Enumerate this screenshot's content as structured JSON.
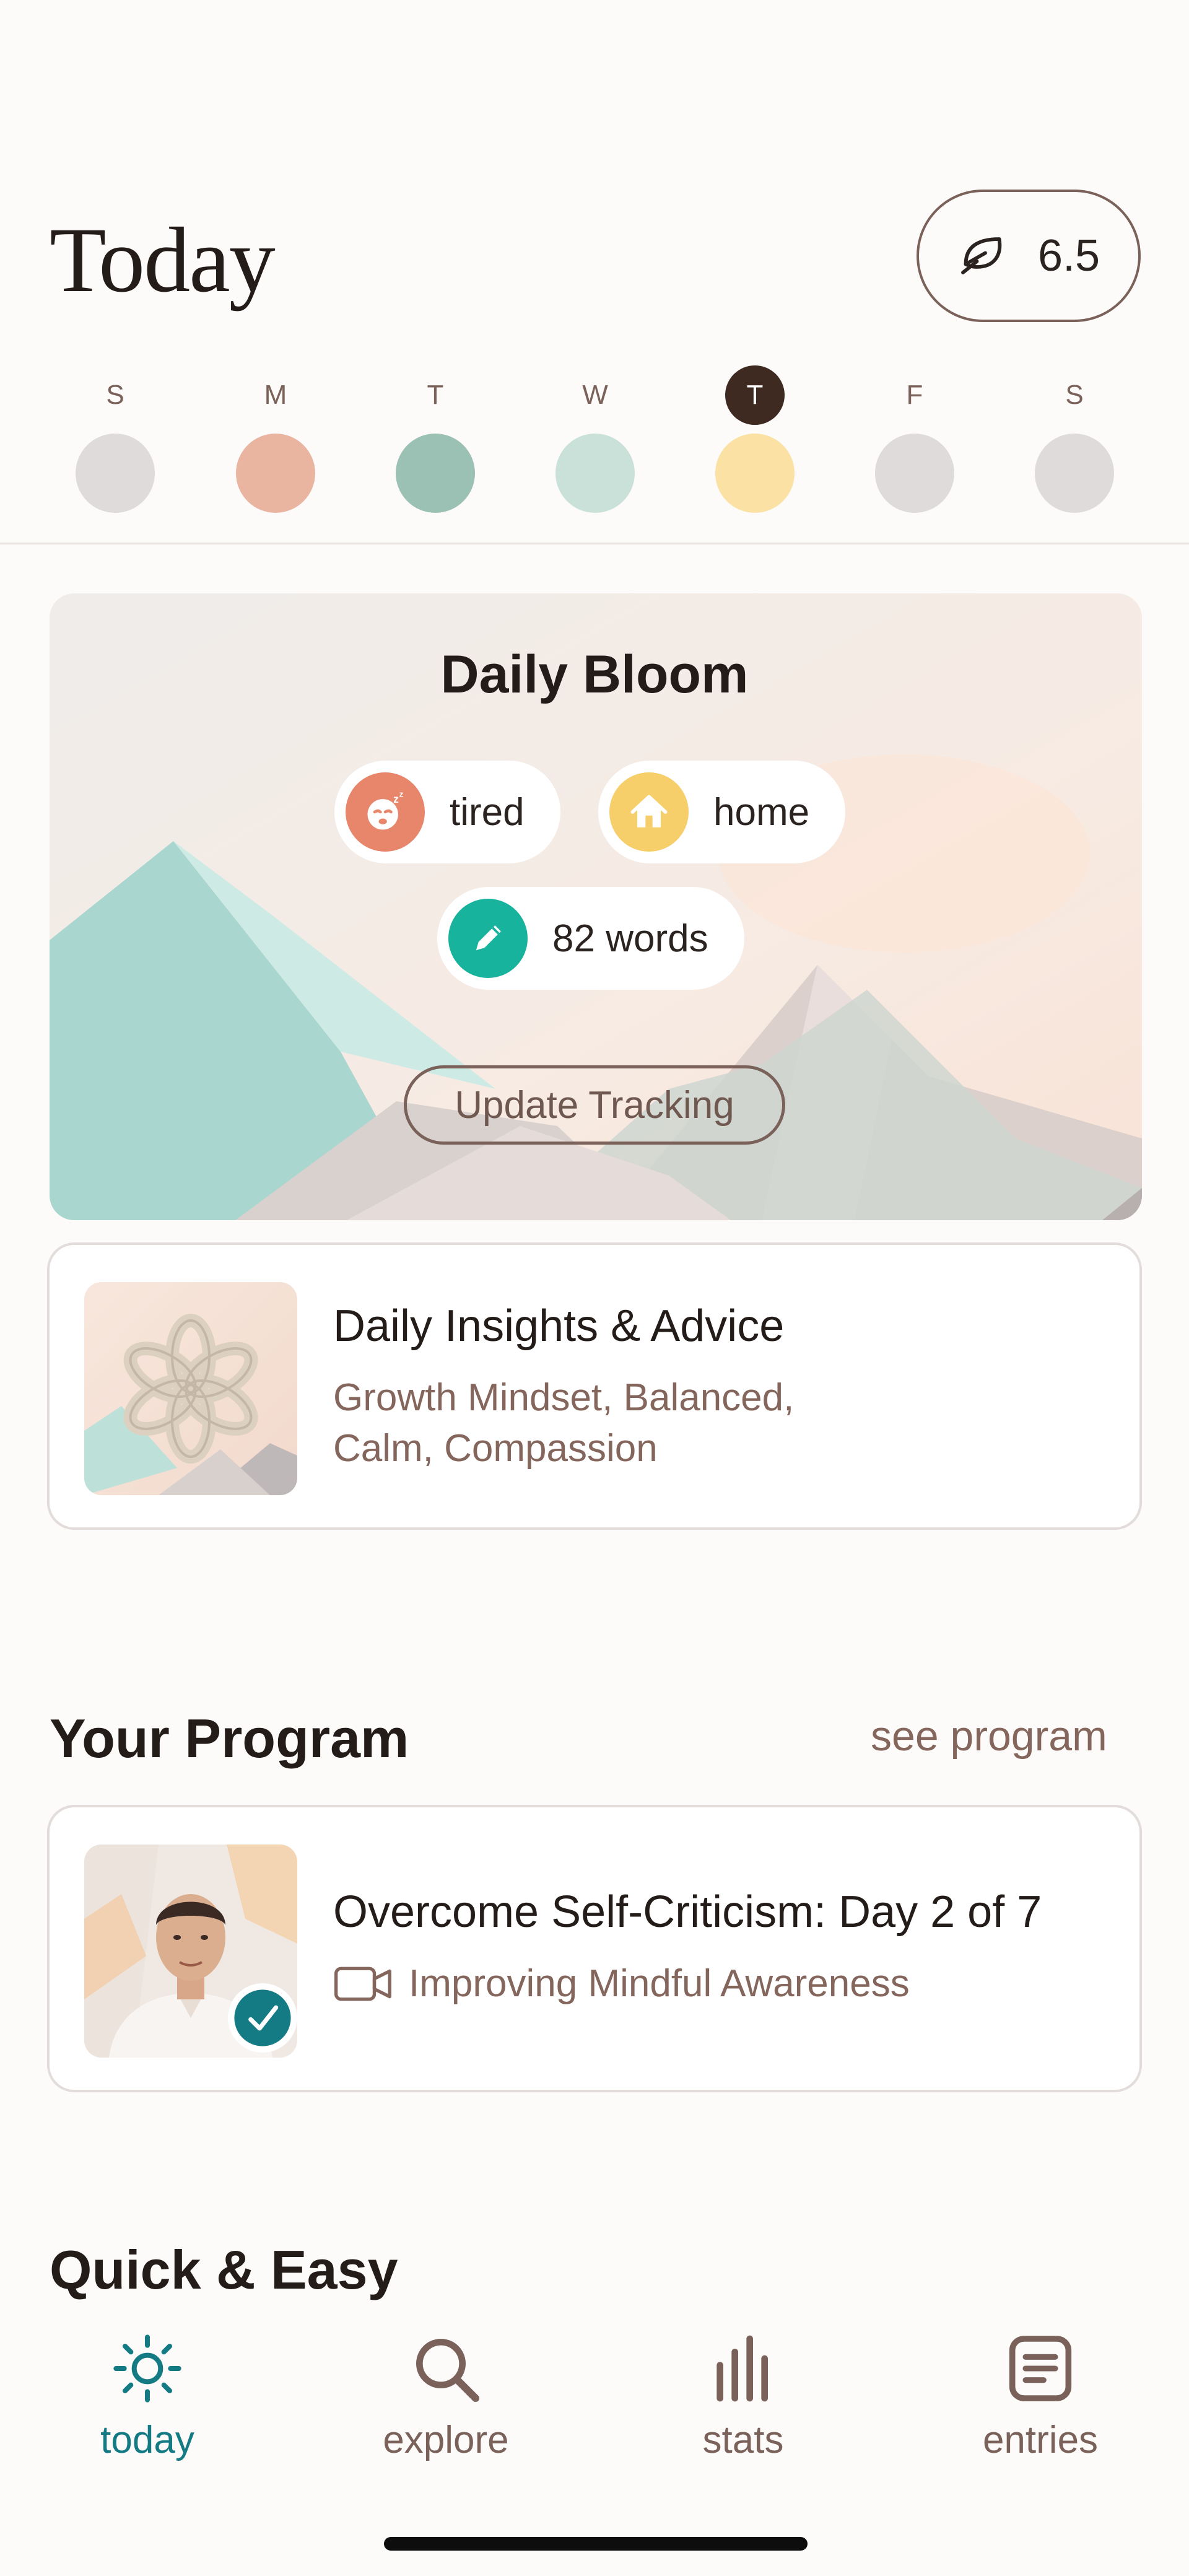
{
  "header": {
    "title": "Today",
    "score": "6.5",
    "score_icon": "leaf-icon"
  },
  "week": [
    {
      "letter": "S",
      "color": "#dedbda",
      "active": false
    },
    {
      "letter": "M",
      "color": "#eab5a0",
      "active": false
    },
    {
      "letter": "T",
      "color": "#9bc0b4",
      "active": false
    },
    {
      "letter": "W",
      "color": "#c9e1d8",
      "active": false
    },
    {
      "letter": "T",
      "color": "#fbe1a4",
      "active": true
    },
    {
      "letter": "F",
      "color": "#dedbda",
      "active": false
    },
    {
      "letter": "S",
      "color": "#dedbda",
      "active": false
    }
  ],
  "bloom": {
    "title": "Daily Bloom",
    "chips": [
      {
        "label": "tired",
        "icon": "tired-face-icon",
        "color": "#e8866c"
      },
      {
        "label": "home",
        "icon": "house-icon",
        "color": "#f6cf6b"
      },
      {
        "label": "82 words",
        "icon": "pencil-icon",
        "color": "#17b39d"
      }
    ],
    "update_label": "Update Tracking"
  },
  "insights": {
    "title": "Daily Insights & Advice",
    "subtitle_line1": "Growth Mindset, Balanced,",
    "subtitle_line2": "Calm, Compassion"
  },
  "program": {
    "section_title": "Your Program",
    "see_link": "see program",
    "title": "Overcome Self-Criticism: Day 2 of 7",
    "subtitle": "Improving Mindful Awareness",
    "completed": true
  },
  "quick": {
    "section_title": "Quick & Easy"
  },
  "nav": {
    "items": [
      {
        "label": "today",
        "icon": "sun-icon",
        "active": true
      },
      {
        "label": "explore",
        "icon": "search-icon",
        "active": false
      },
      {
        "label": "stats",
        "icon": "bar-chart-icon",
        "active": false
      },
      {
        "label": "entries",
        "icon": "journal-icon",
        "active": false
      }
    ],
    "active_color": "#147b85",
    "inactive_color": "#7a625a"
  }
}
